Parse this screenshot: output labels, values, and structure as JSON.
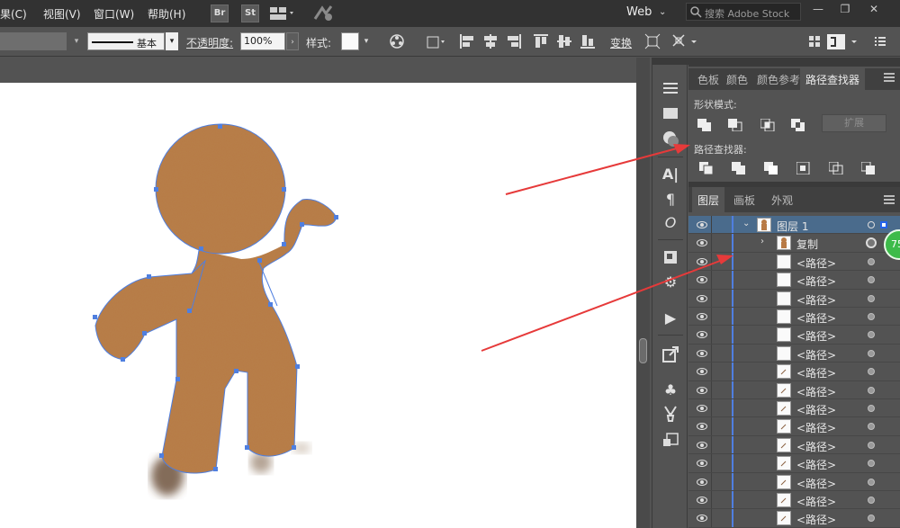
{
  "menu": {
    "items": [
      "果(C)",
      "视图(V)",
      "窗口(W)",
      "帮助(H)"
    ],
    "app_icons": [
      "Br",
      "St"
    ],
    "workspace": "Web",
    "search_placeholder": "搜索 Adobe Stock",
    "window_controls": [
      "—",
      "❐",
      "✕"
    ]
  },
  "control_bar": {
    "stroke_profile": "基本",
    "opacity_label": "不透明度:",
    "opacity_value": "100%",
    "style_label": "样式:",
    "transform_label": "变换"
  },
  "panels": {
    "top_tabs": [
      "色板",
      "颜色",
      "颜色参考",
      "路径查找器"
    ],
    "active_top_tab": "路径查找器",
    "shape_modes_label": "形状模式:",
    "expand_label": "扩展",
    "pathfinders_label": "路径查找器:",
    "bottom_tabs": [
      "图层",
      "画板",
      "外观"
    ],
    "active_bottom_tab": "图层"
  },
  "layers": {
    "top_layer": "图层 1",
    "group": "复制",
    "path_label": "<路径>",
    "path_count": 16
  },
  "badge": {
    "text": "75"
  },
  "colors": {
    "ui_dark": "#323232",
    "ui_mid": "#535353",
    "selection_blue": "#4f7fe0",
    "gingerbread": "#b87a45",
    "arrow_red": "#e63a3a"
  }
}
